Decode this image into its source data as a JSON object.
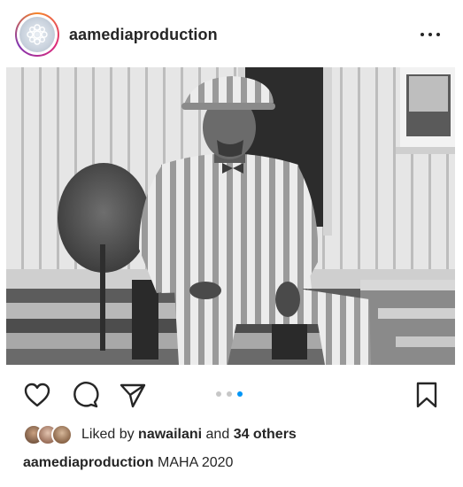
{
  "post": {
    "username": "aamediaproduction",
    "more_icon": "ellipsis-icon",
    "image_alt": "Black and white photograph of a man in a striped suit and cap seated on a chair on the steps of a white wooden house beside a shrub",
    "carousel": {
      "total": 3,
      "active_index": 2,
      "active_color": "#0095f6",
      "inactive_color": "#c7c7c7"
    },
    "actions": {
      "like_icon": "heart-icon",
      "comment_icon": "comment-bubble-icon",
      "share_icon": "paper-plane-icon",
      "save_icon": "bookmark-icon"
    },
    "likes": {
      "prefix": "Liked by",
      "user": "nawailani",
      "conjunction": "and",
      "others": "34 others"
    },
    "caption": {
      "username": "aamediaproduction",
      "text": "MAHA 2020"
    }
  }
}
